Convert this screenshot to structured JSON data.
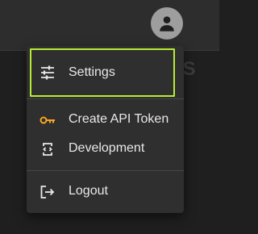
{
  "header": {
    "avatar_icon": "account-circle-icon",
    "background_text": "IS"
  },
  "menu": {
    "items": [
      {
        "label": "Settings",
        "icon": "tune-icon",
        "focused": true
      },
      {
        "label": "Create API Token",
        "icon": "key-icon",
        "icon_color": "#f5a623"
      },
      {
        "label": "Development",
        "icon": "developer-board-icon"
      },
      {
        "label": "Logout",
        "icon": "logout-icon"
      }
    ]
  },
  "colors": {
    "focus_outline": "#b7ec34",
    "menu_background": "#2f2f2f",
    "text": "#e9e9e9",
    "key_icon": "#f5a623"
  }
}
